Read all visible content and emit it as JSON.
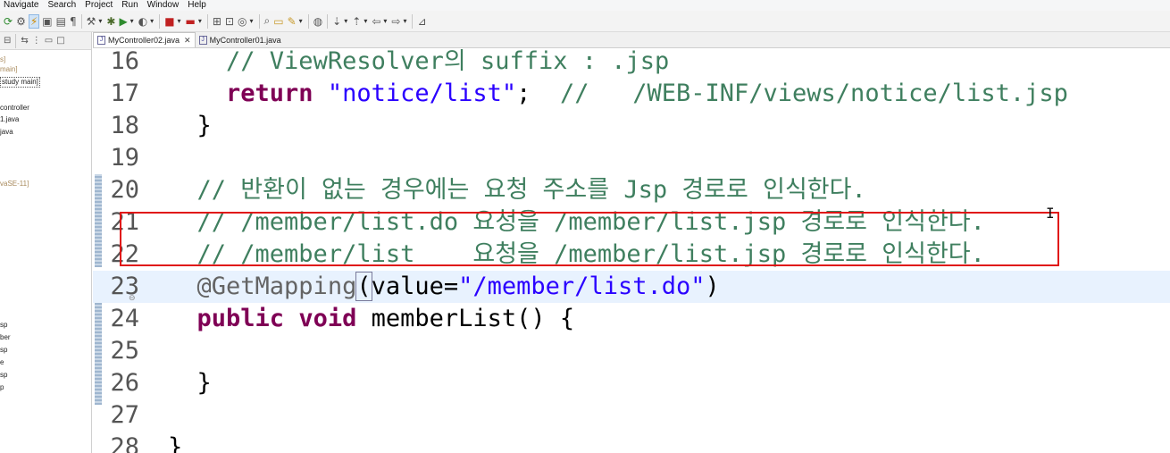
{
  "menu": [
    "Navigate",
    "Search",
    "Project",
    "Run",
    "Window",
    "Help"
  ],
  "toolbar_icons": [
    "new-icon",
    "debug-toggle-icon",
    "lightning-icon",
    "save-icon",
    "print-icon",
    "pilcrow-icon",
    "build-icon",
    "bug-icon",
    "run-icon",
    "coverage-icon",
    "stop-icon",
    "server-icon",
    "open-type-icon",
    "open-resource-icon",
    "new-class-icon",
    "search-icon",
    "folder-icon",
    "pencil-icon",
    "globe-icon",
    "next-annotation-icon",
    "prev-annotation-icon",
    "back-icon",
    "forward-icon",
    "pin-icon"
  ],
  "explorer": {
    "items": [
      {
        "text": "s]",
        "muted": true
      },
      {
        "text": "main]",
        "muted": true
      },
      {
        "text": "study main]",
        "selected": true
      },
      {
        "text": "controller"
      },
      {
        "text": "1.java"
      },
      {
        "text": "java"
      },
      {
        "text": "vaSE-11]",
        "muted": true
      },
      {
        "text": "sp"
      },
      {
        "text": "ber"
      },
      {
        "text": "sp"
      },
      {
        "text": "e"
      },
      {
        "text": "sp"
      },
      {
        "text": "p"
      }
    ]
  },
  "tabs": [
    {
      "label": "MyController02.java",
      "active": true,
      "closable": "✕"
    },
    {
      "label": "MyController01.java",
      "active": false
    }
  ],
  "code": {
    "lines": [
      {
        "num": "16",
        "tokens": [
          {
            "t": "    "
          },
          {
            "t": "// ViewResolver의 suffix : .jsp",
            "c": "cm"
          }
        ]
      },
      {
        "num": "17",
        "tokens": [
          {
            "t": "    "
          },
          {
            "t": "return",
            "c": "kw"
          },
          {
            "t": " "
          },
          {
            "t": "\"notice/list\"",
            "c": "str"
          },
          {
            "t": ";  "
          },
          {
            "t": "//   /WEB-INF/views/notice/list.jsp",
            "c": "cm"
          }
        ]
      },
      {
        "num": "18",
        "tokens": [
          {
            "t": "  }"
          }
        ]
      },
      {
        "num": "19",
        "tokens": []
      },
      {
        "num": "20",
        "tokens": [
          {
            "t": "  "
          },
          {
            "t": "// 반환이 없는 경우에는 요청 주소를 Jsp 경로로 인식한다.",
            "c": "cm"
          }
        ]
      },
      {
        "num": "21",
        "tokens": [
          {
            "t": "  "
          },
          {
            "t": "// /member/list.do 요청을 /member/list.jsp 경로로 인식한다.",
            "c": "cm"
          }
        ]
      },
      {
        "num": "22",
        "tokens": [
          {
            "t": "  "
          },
          {
            "t": "// /member/list    요청을 /member/list.jsp 경로로 인식한다.",
            "c": "cm"
          }
        ]
      },
      {
        "num": "23",
        "tokens": [
          {
            "t": "  "
          },
          {
            "t": "@GetMapping",
            "c": "ann"
          },
          {
            "t": "(",
            "c": "brk"
          },
          {
            "t": "value="
          },
          {
            "t": "\"/member/list.do\"",
            "c": "str"
          },
          {
            "t": ")"
          }
        ],
        "current": true,
        "fold": true
      },
      {
        "num": "24",
        "tokens": [
          {
            "t": "  "
          },
          {
            "t": "public",
            "c": "kw"
          },
          {
            "t": " "
          },
          {
            "t": "void",
            "c": "kw"
          },
          {
            "t": " memberList() {"
          }
        ]
      },
      {
        "num": "25",
        "tokens": []
      },
      {
        "num": "26",
        "tokens": [
          {
            "t": "  }"
          }
        ]
      },
      {
        "num": "27",
        "tokens": []
      },
      {
        "num": "28",
        "tokens": [
          {
            "t": "}"
          }
        ]
      }
    ]
  },
  "colors": {
    "highlight_box": "#e01515",
    "comment": "#3f7f5f",
    "keyword": "#7f0055",
    "string": "#2a00ff",
    "annotation": "#646464"
  }
}
